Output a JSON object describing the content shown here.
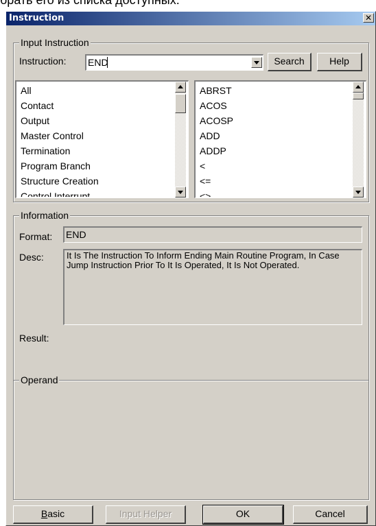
{
  "background_text": "брать его из списка доступных.",
  "window": {
    "title": "Instruction",
    "close_glyph": "✕"
  },
  "input_group": {
    "legend": "Input Instruction",
    "instruction_label": "Instruction:",
    "instruction_value": "END",
    "search_label": "Search",
    "help_label": "Help",
    "categories": [
      "All",
      "Contact",
      "Output",
      "Master Control",
      "Termination",
      "Program Branch",
      "Structure Creation",
      "Control Interrupt"
    ],
    "instructions": [
      "ABRST",
      "ACOS",
      "ACOSP",
      "ADD",
      "ADDP",
      "<",
      "<=",
      "<>"
    ]
  },
  "information_group": {
    "legend": "Information",
    "format_label": "Format:",
    "format_value": "END",
    "desc_label": "Desc:",
    "desc_value": "It Is The Instruction To Inform Ending Main Routine Program, In Case Jump Instruction Prior To It Is Operated, It Is Not Operated.",
    "result_label": "Result:"
  },
  "operand_group": {
    "legend": "Operand"
  },
  "buttons": {
    "basic_first": "B",
    "basic_rest": "asic",
    "input_helper": "Input Helper",
    "ok": "OK",
    "cancel": "Cancel"
  }
}
